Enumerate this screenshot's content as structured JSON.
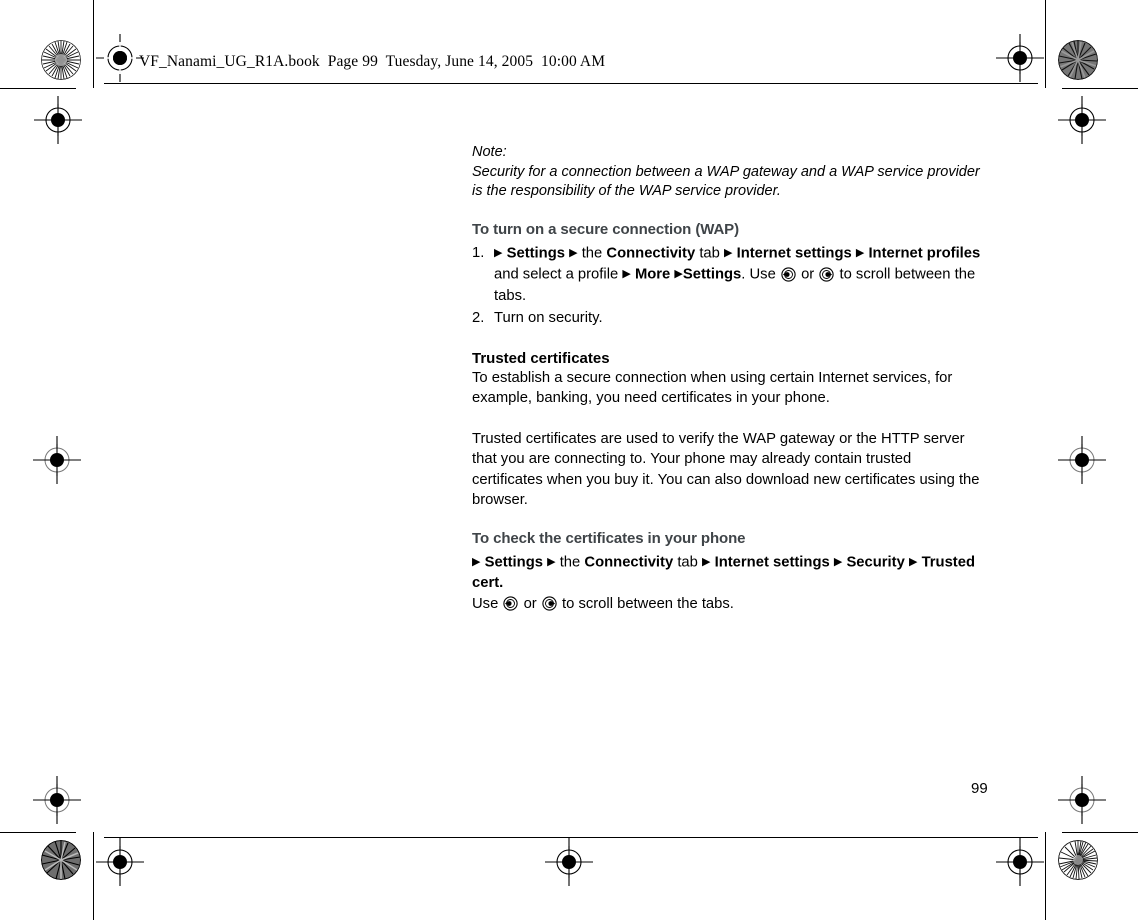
{
  "header": {
    "file_line": "VF_Nanami_UG_R1A.book  Page 99  Tuesday, June 14, 2005  10:00 AM"
  },
  "note": {
    "label": "Note:",
    "text": "Security for a connection between a WAP gateway and a WAP service provider is the responsibility of the WAP service provider."
  },
  "section_wap": {
    "heading": "To turn on a secure connection (WAP)",
    "steps": [
      {
        "number": "1.",
        "parts": {
          "arrow1": "▶",
          "settings": "Settings",
          "arrow2": "▶",
          "the": "the",
          "connectivity": "Connectivity",
          "tab": "tab",
          "arrow3": "▶",
          "internet_settings": "Internet settings",
          "arrow4": "▶",
          "internet_profiles": "Internet profiles",
          "and_select": "and select a profile",
          "arrow5": "▶",
          "more": "More",
          "arrow6": "▶",
          "settings2": "Settings",
          "use": ". Use",
          "or": "or",
          "scroll": "to scroll between the tabs."
        }
      },
      {
        "number": "2.",
        "text": "Turn on security."
      }
    ]
  },
  "section_trusted": {
    "heading": "Trusted certificates",
    "paragraph1": "To establish a secure connection when using certain Internet services, for example, banking, you need certificates in your phone.",
    "paragraph2": "Trusted certificates are used to verify the WAP gateway or the HTTP server that you are connecting to. Your phone may already contain trusted certificates when you buy it. You can also download new certificates using the browser."
  },
  "section_check": {
    "heading": "To check the certificates in your phone",
    "path": {
      "arrow1": "▶",
      "settings": "Settings",
      "arrow2": "▶",
      "the": "the",
      "connectivity": "Connectivity",
      "tab": "tab",
      "arrow3": "▶",
      "internet_settings": "Internet settings",
      "arrow4": "▶",
      "security": "Security",
      "arrow5": "▶",
      "trusted_cert": "Trusted cert."
    },
    "use_line": {
      "use": "Use",
      "or": "or",
      "scroll": "to scroll between the tabs."
    }
  },
  "footer": {
    "page_number": "99"
  },
  "icons": {
    "scroll_left_key": "scroll-left-key-icon",
    "scroll_right_key": "scroll-right-key-icon",
    "registration_target": "registration-target-icon",
    "rosette": "print-rosette-icon"
  },
  "colors": {
    "heading": "#3f4448",
    "text": "#000000",
    "background": "#ffffff"
  }
}
